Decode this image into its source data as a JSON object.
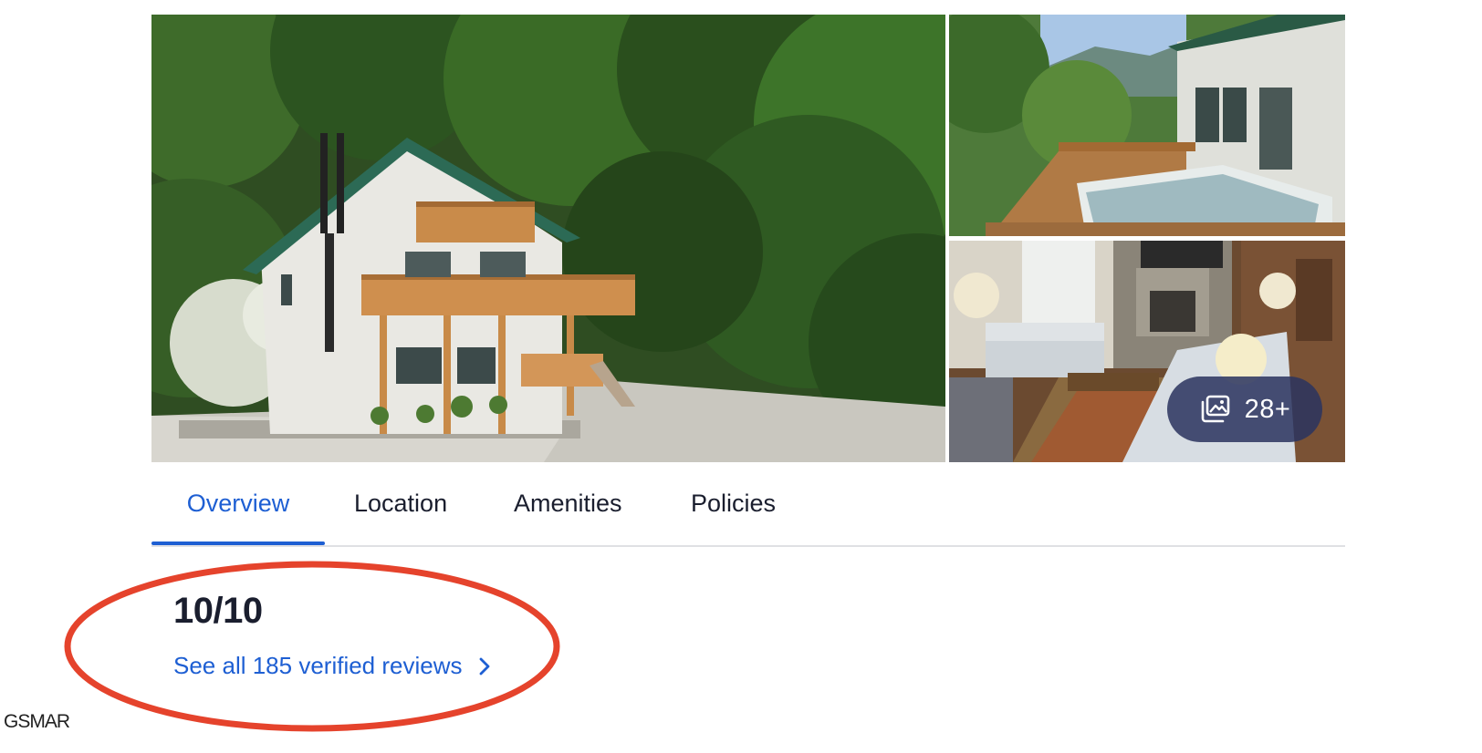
{
  "gallery": {
    "photo_count_label": "28+",
    "photos": [
      {
        "icon": "house-exterior-photo"
      },
      {
        "icon": "hot-tub-deck-photo"
      },
      {
        "icon": "living-room-photo"
      }
    ]
  },
  "tabs": [
    {
      "label": "Overview",
      "selected": true
    },
    {
      "label": "Location",
      "selected": false
    },
    {
      "label": "Amenities",
      "selected": false
    },
    {
      "label": "Policies",
      "selected": false
    }
  ],
  "rating": {
    "score": "10/10",
    "reviews_link": "See all 185 verified reviews"
  },
  "watermark": "GSMAR",
  "colors": {
    "accent": "#1e5fd3",
    "annotation": "#e5432c",
    "badge_bg": "#2b3460"
  }
}
